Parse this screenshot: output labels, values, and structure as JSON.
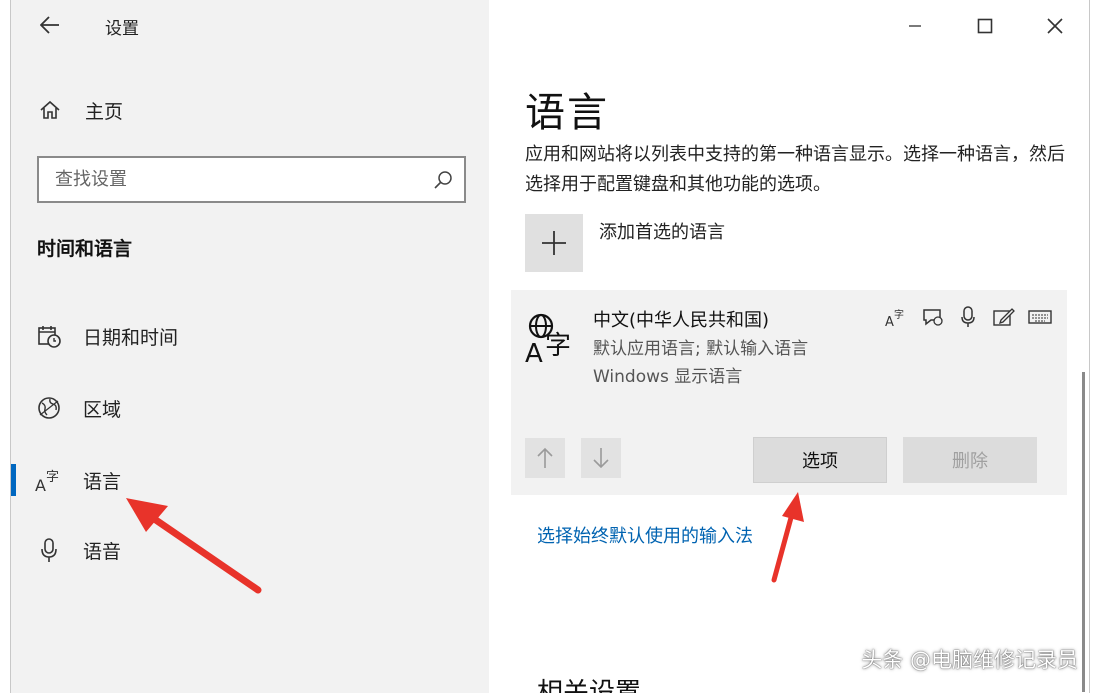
{
  "window": {
    "app_title": "设置",
    "back_icon": "back-arrow-icon",
    "caption": {
      "minimize_icon": "minimize-icon",
      "maximize_icon": "maximize-icon",
      "close_icon": "close-icon"
    }
  },
  "sidebar": {
    "home_label": "主页",
    "search_placeholder": "查找设置",
    "section_heading": "时间和语言",
    "items": [
      {
        "label": "日期和时间",
        "icon": "calendar-clock-icon",
        "active": false
      },
      {
        "label": "区域",
        "icon": "globe-icon",
        "active": false
      },
      {
        "label": "语言",
        "icon": "language-icon",
        "active": true
      },
      {
        "label": "语音",
        "icon": "microphone-icon",
        "active": false
      }
    ]
  },
  "main": {
    "title": "语言",
    "description": "应用和网站将以列表中支持的第一种语言显示。选择一种语言，然后选择用于配置键盘和其他功能的选项。",
    "add_language_label": "添加首选的语言",
    "language": {
      "name": "中文(中华人民共和国)",
      "subtitle1": "默认应用语言; 默认输入语言",
      "subtitle2": "Windows 显示语言",
      "feature_icons": [
        "display-language-icon",
        "speech-icon",
        "microphone-icon",
        "handwriting-icon",
        "keyboard-icon"
      ]
    },
    "options_button": "选项",
    "delete_button": "删除",
    "ime_link": "选择始终默认使用的输入法",
    "related_heading": "相关设置"
  },
  "accent_color": "#0067c0",
  "link_color": "#0063b1",
  "annotation_color": "#e8332a",
  "watermark": "头条 @电脑维修记录员"
}
